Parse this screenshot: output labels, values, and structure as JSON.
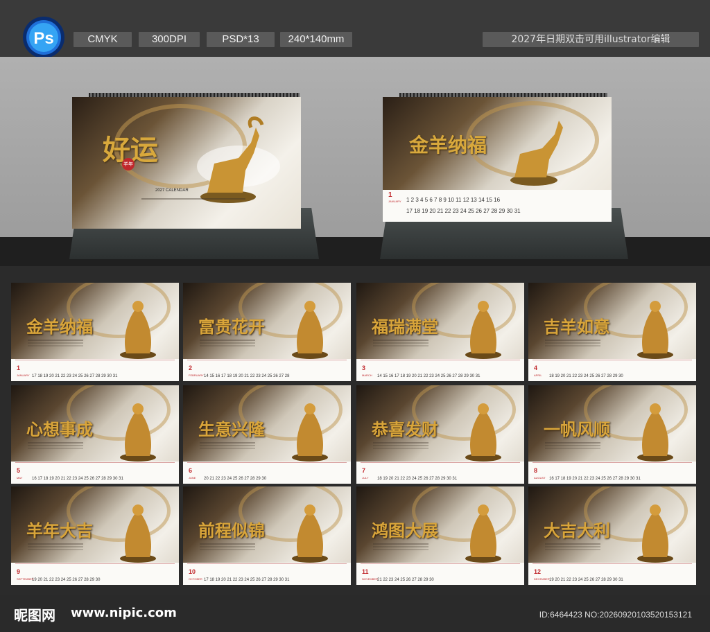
{
  "header": {
    "app_icon": "photoshop-icon",
    "app_letters": "Ps",
    "tags": [
      "CMYK",
      "300DPI",
      "PSD*13",
      "240*140mm"
    ],
    "note": "2027年日期双击可用illustrator编辑"
  },
  "cover": {
    "calligraphy": "好运",
    "seal": "羊年",
    "subtitle": "2027 CALENDAR"
  },
  "january_page": {
    "title": "金羊纳福",
    "month_num": "1",
    "month_en": "JANUARY",
    "days_row1": "1  2  3  4  5  6  7  8  9  10  11  12  13  14  15  16",
    "days_row2": "17 18 19 20 21 22 23 24 25 26 27 28 29 30 31"
  },
  "months": [
    {
      "num": "1",
      "en": "JANUARY",
      "title": "金羊纳福",
      "row": "17 18 19 20 21 22 23 24 25 26 27 28 29 30 31"
    },
    {
      "num": "2",
      "en": "FEBRUARY",
      "title": "富贵花开",
      "row": "14 15 16 17 18 19 20 21 22 23 24 25 26 27 28"
    },
    {
      "num": "3",
      "en": "MARCH",
      "title": "福瑞满堂",
      "row": "14 15 16 17 18 19 20 21 22 23 24 25 26 27 28 29 30 31"
    },
    {
      "num": "4",
      "en": "APRIL",
      "title": "吉羊如意",
      "row": "18 19 20 21 22 23 24 25 26 27 28 29 30"
    },
    {
      "num": "5",
      "en": "MAY",
      "title": "心想事成",
      "row": "16 17 18 19 20 21 22 23 24 25 26 27 28 29 30 31"
    },
    {
      "num": "6",
      "en": "JUNE",
      "title": "生意兴隆",
      "row": "20 21 22 23 24 25 26 27 28 29 30"
    },
    {
      "num": "7",
      "en": "JULY",
      "title": "恭喜发财",
      "row": "18 19 20 21 22 23 24 25 26 27 28 29 30 31"
    },
    {
      "num": "8",
      "en": "AUGUST",
      "title": "一帆风顺",
      "row": "16 17 18 19 20 21 22 23 24 25 26 27 28 29 30 31"
    },
    {
      "num": "9",
      "en": "SEPTEMBER",
      "title": "羊年大吉",
      "row": "19 20 21 22 23 24 25 26 27 28 29 30"
    },
    {
      "num": "10",
      "en": "OCTOBER",
      "title": "前程似锦",
      "row": "17 18 19 20 21 22 23 24 25 26 27 28 29 30 31"
    },
    {
      "num": "11",
      "en": "NOVEMBER",
      "title": "鸿图大展",
      "row": "21 22 23 24 25 26 27 28 29 30"
    },
    {
      "num": "12",
      "en": "DECEMBER",
      "title": "大吉大利",
      "row": "19 20 21 22 23 24 25 26 27 28 29 30 31"
    }
  ],
  "footer": {
    "brand": "昵图网",
    "site": "www.nipic.com",
    "id_text": "ID:6464423 NO:20260920103520153121"
  },
  "colors": {
    "gold": "#d8a83c",
    "red": "#c0282c",
    "ps_blue": "#31a8ff",
    "ps_bg": "#001e36"
  }
}
